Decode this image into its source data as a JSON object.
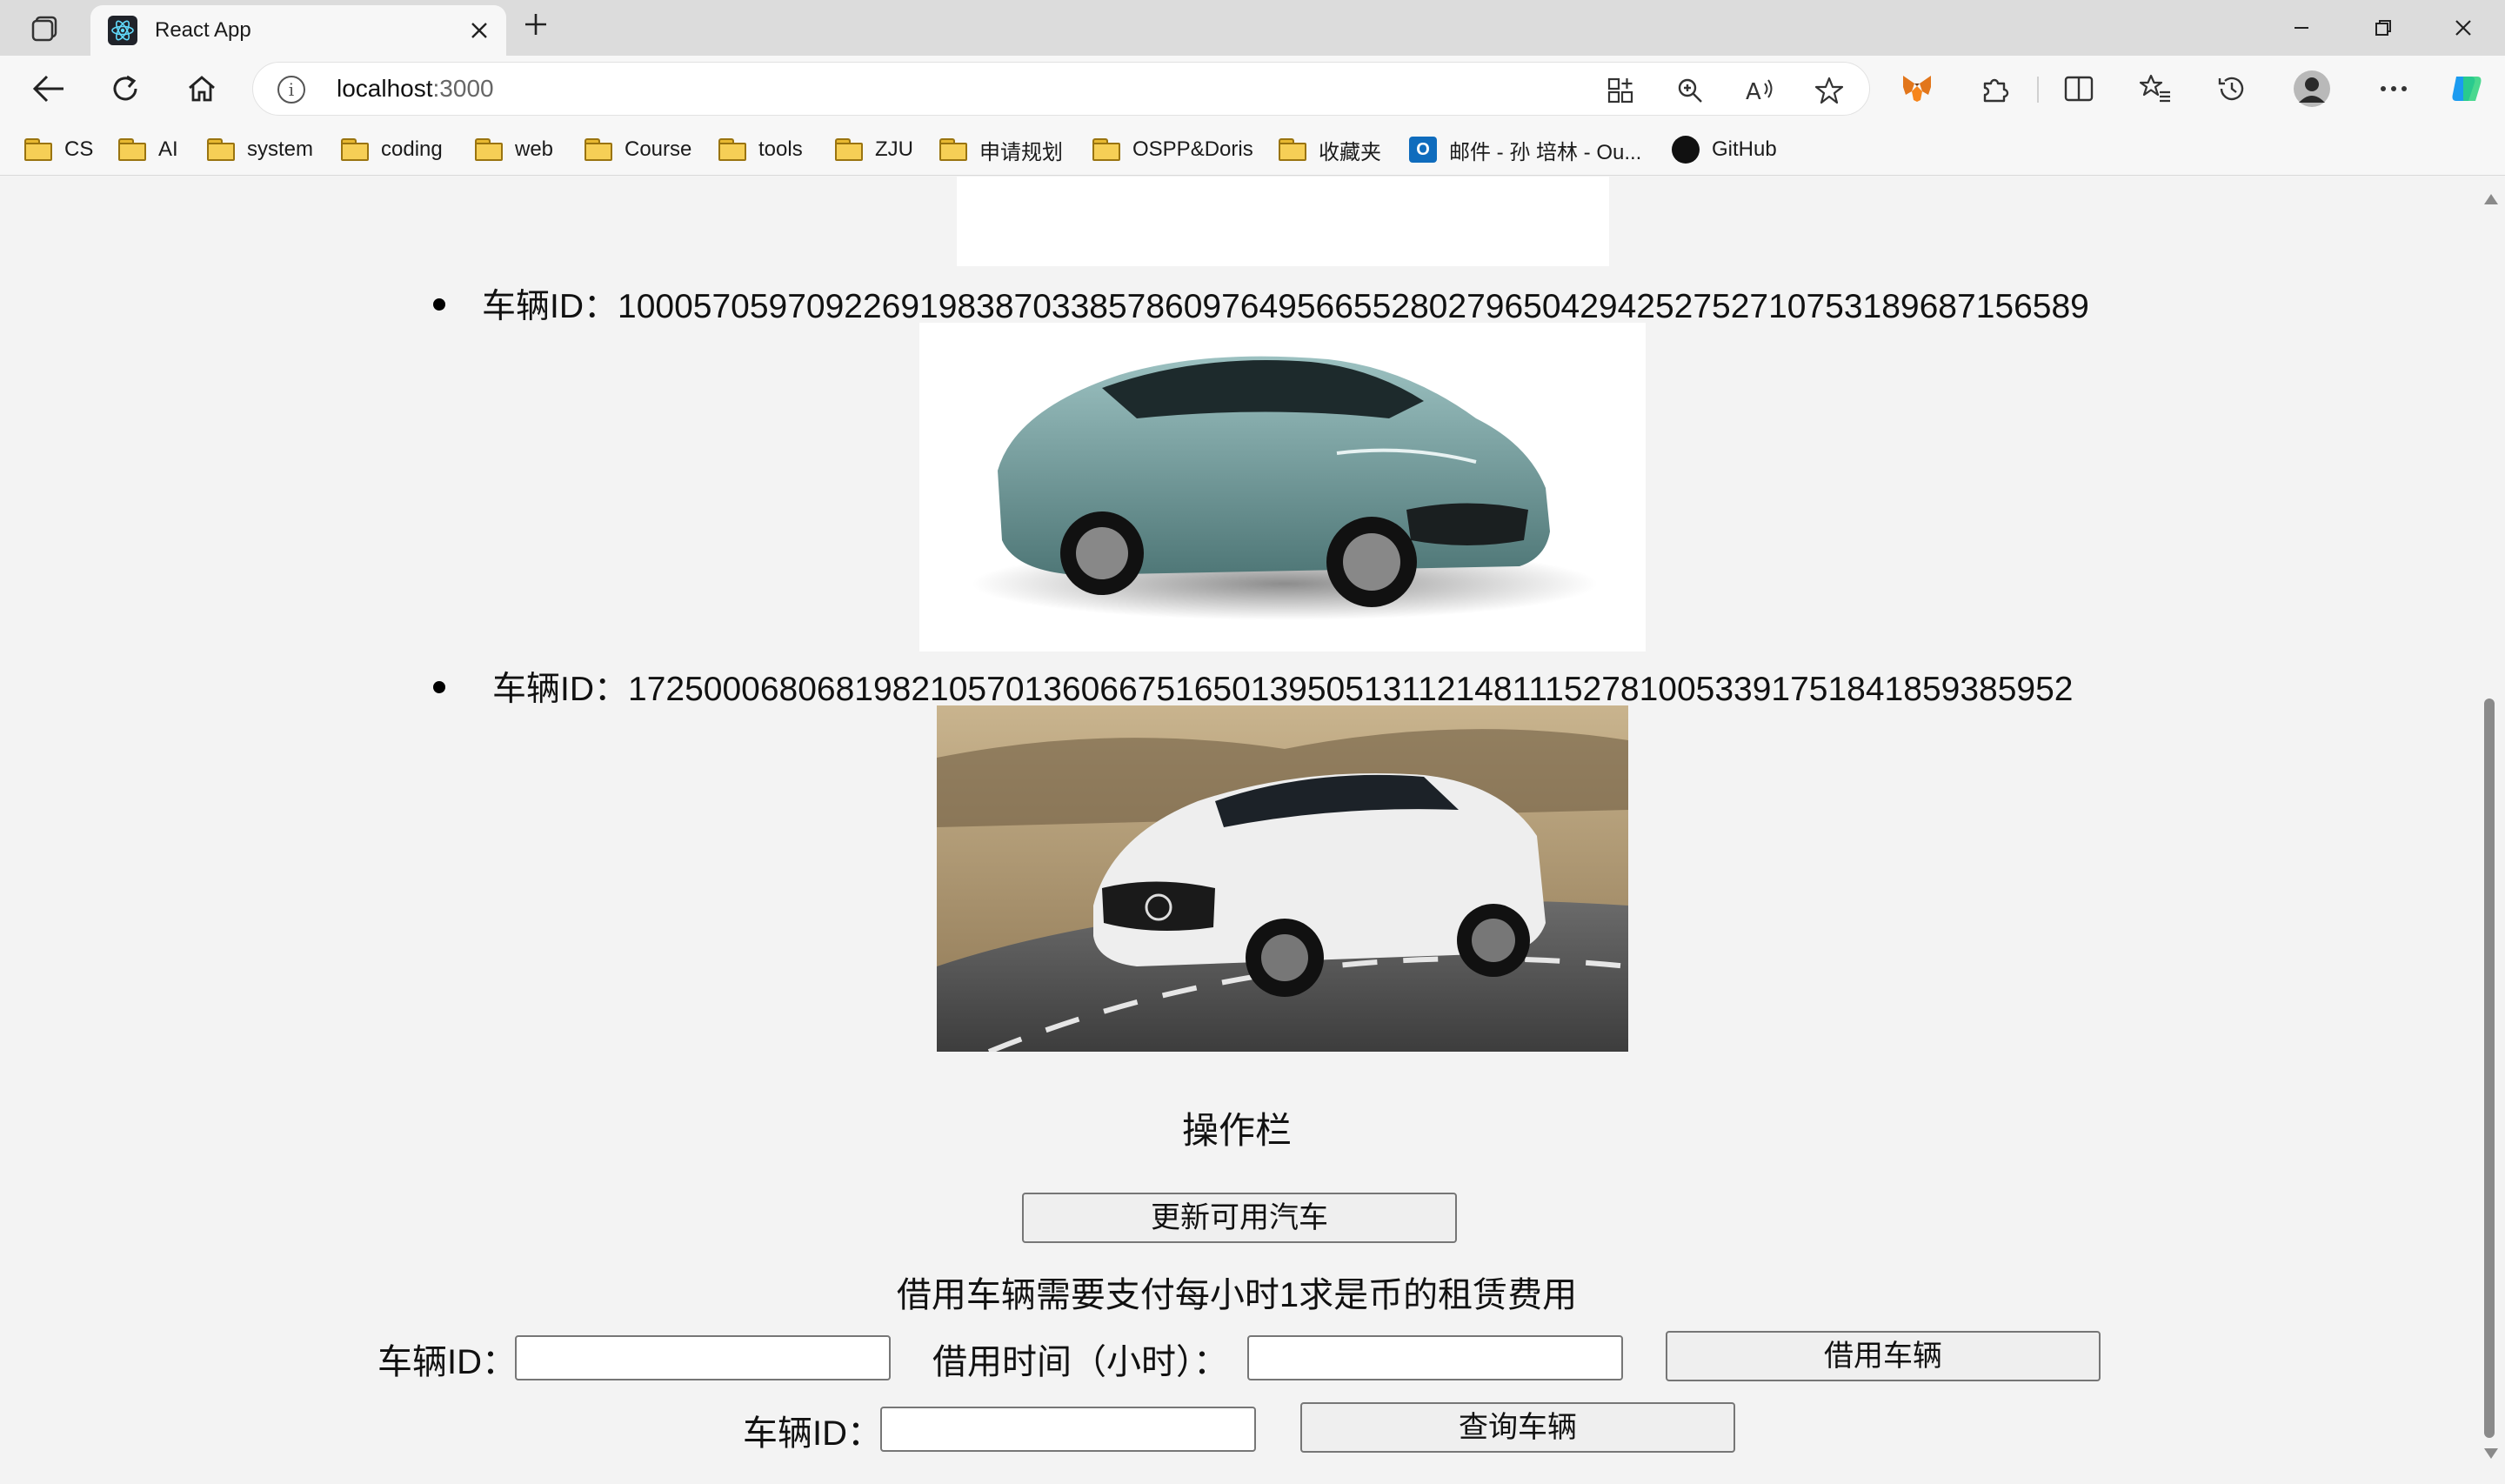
{
  "browser": {
    "tab_title": "React App",
    "url_host": "localhost",
    "url_port": ":3000",
    "bookmarks": [
      {
        "label": "CS",
        "kind": "folder"
      },
      {
        "label": "AI",
        "kind": "folder"
      },
      {
        "label": "system",
        "kind": "folder"
      },
      {
        "label": "coding",
        "kind": "folder"
      },
      {
        "label": "web",
        "kind": "folder"
      },
      {
        "label": "Course",
        "kind": "folder"
      },
      {
        "label": "tools",
        "kind": "folder"
      },
      {
        "label": "ZJU",
        "kind": "folder"
      },
      {
        "label": "申请规划",
        "kind": "folder"
      },
      {
        "label": "OSPP&Doris",
        "kind": "folder"
      },
      {
        "label": "收藏夹",
        "kind": "folder"
      },
      {
        "label": "邮件 - 孙 培林 - Ou...",
        "kind": "outlook"
      },
      {
        "label": "GitHub",
        "kind": "github"
      }
    ]
  },
  "cars": [
    {
      "id_label": "车辆ID：",
      "id_value": "10005705970922691983870338578609764956655280279650429425275271075318968715658​9",
      "image": "teal-sedan"
    },
    {
      "id_label": "车辆ID：",
      "id_value": "17250006806819821057013606675165013950513112148111527810053391751841859385952",
      "image": "white-suv"
    }
  ],
  "operations": {
    "title": "操作栏",
    "refresh_button": "更新可用汽车",
    "rent_note": "借用车辆需要支付每小时1求是币的租赁费用",
    "rent_id_label": "车辆ID：",
    "rent_hours_label": "借用时间（小时）：",
    "rent_button": "借用车辆",
    "query_id_label": "车辆ID：",
    "query_button": "查询车辆",
    "rent_id_value": "",
    "rent_hours_value": "",
    "query_id_value": ""
  },
  "colors": {
    "titlebar": "#dcdcdc",
    "toolbar": "#f7f7f7",
    "page_bg": "#f3f3f3",
    "button_bg": "#efefef",
    "button_border": "#767676"
  }
}
